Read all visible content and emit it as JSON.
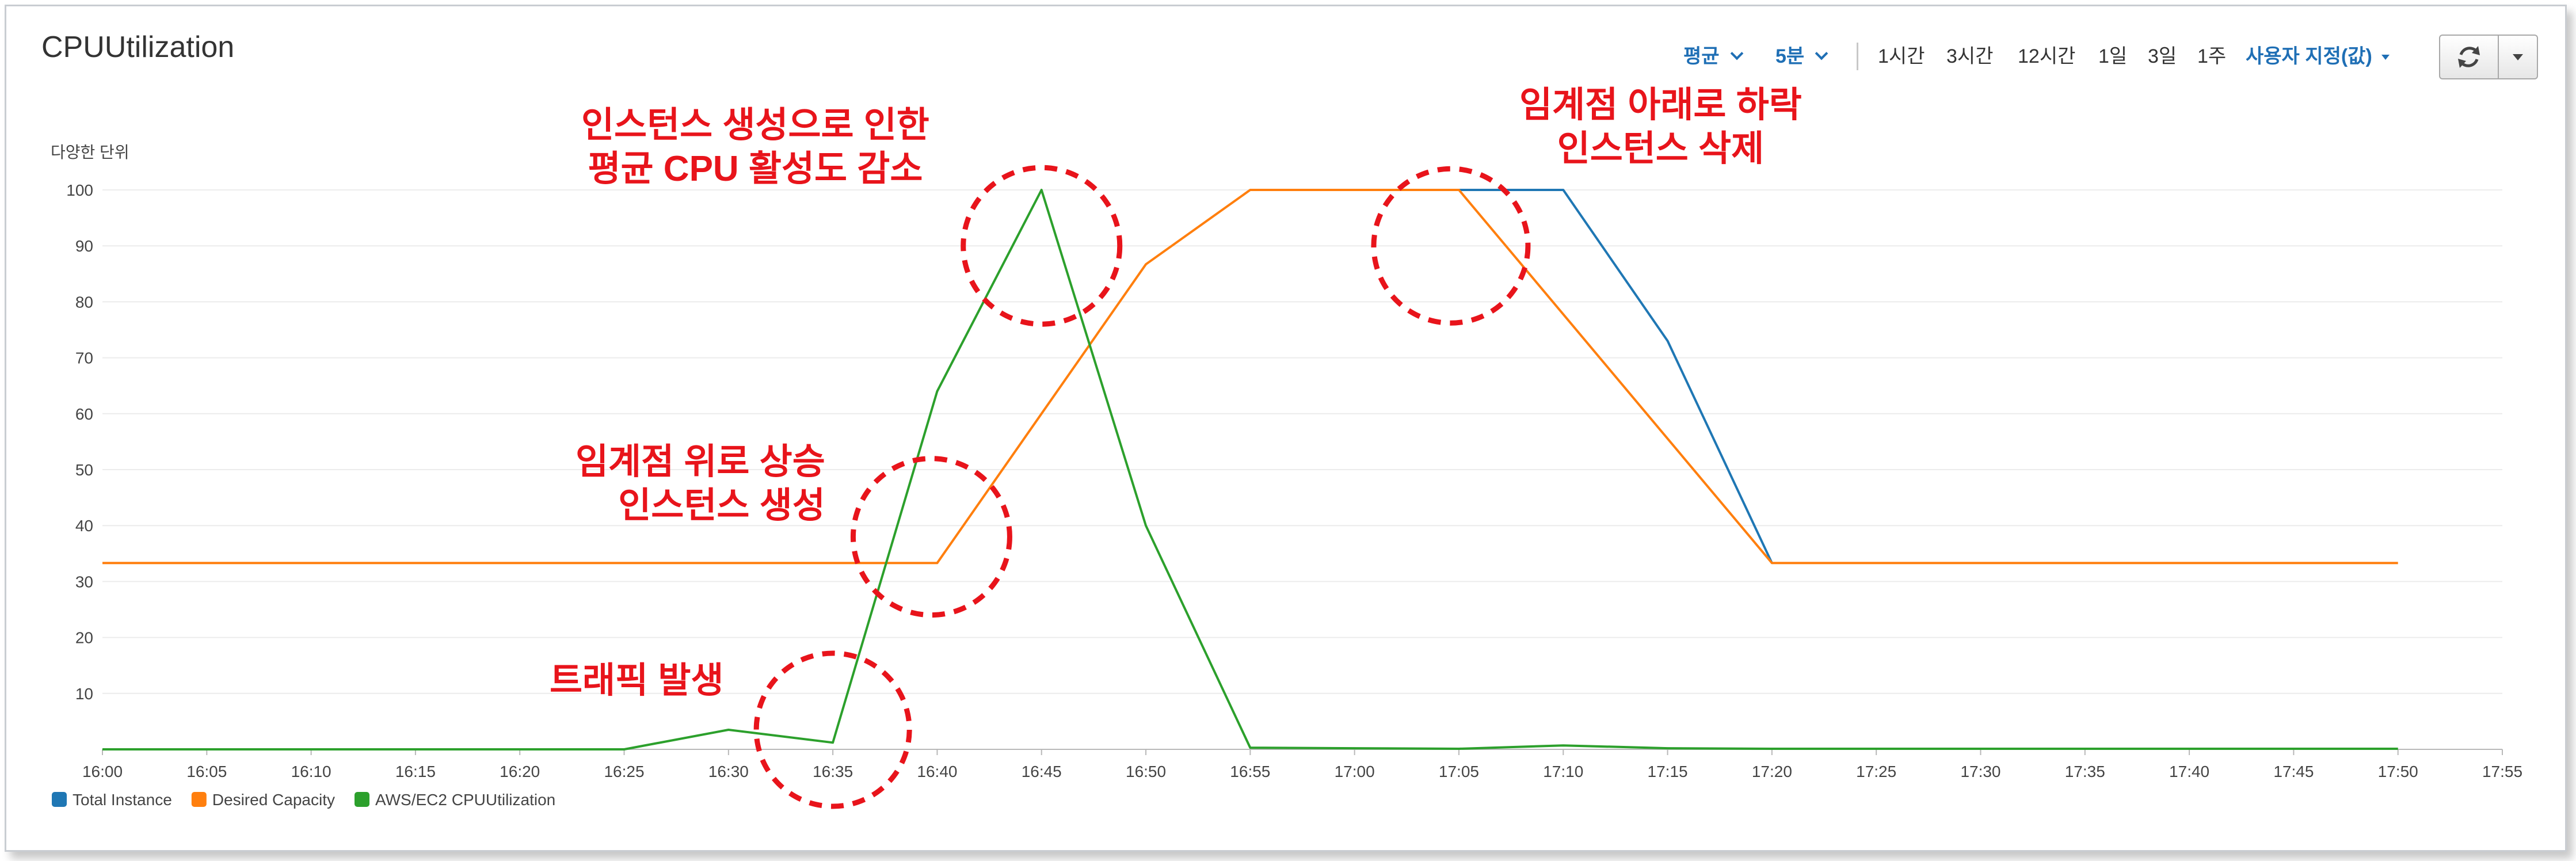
{
  "panel": {
    "title": "CPUUtilization"
  },
  "controls": {
    "statistic": "평균",
    "period": "5분",
    "ranges": [
      "1시간",
      "3시간",
      "12시간",
      "1일",
      "3일",
      "1주"
    ],
    "custom": "사용자 지정(값)",
    "refresh_icon": "refresh-icon",
    "menu_icon": "caret-down-icon"
  },
  "annotations": {
    "instance_avg": [
      "인스턴스 생성으로 인한",
      "평균 CPU 활성도 감소"
    ],
    "below_threshold": [
      "임계점 아래로 하락",
      "인스턴스 삭제"
    ],
    "above_threshold": [
      "임계점 위로 상승",
      "인스턴스 생성"
    ],
    "traffic": "트래픽 발생",
    "color": "#e8141b"
  },
  "chart_data": {
    "type": "line",
    "ylabel": "다양한 단위",
    "x": [
      "16:00",
      "16:05",
      "16:10",
      "16:15",
      "16:20",
      "16:25",
      "16:30",
      "16:35",
      "16:40",
      "16:45",
      "16:50",
      "16:55",
      "17:00",
      "17:05",
      "17:10",
      "17:15",
      "17:20",
      "17:25",
      "17:30",
      "17:35",
      "17:40",
      "17:45",
      "17:50",
      "17:55"
    ],
    "yticks": [
      10,
      20,
      30,
      40,
      50,
      60,
      70,
      80,
      90,
      100
    ],
    "ylim": [
      0,
      100
    ],
    "grid": true,
    "legend_position": "bottom-left",
    "series": [
      {
        "name": "Total Instance",
        "color": "#1f77b4",
        "points": [
          [
            "17:05",
            100
          ],
          [
            "17:10",
            100
          ],
          [
            "17:15",
            73
          ],
          [
            "17:20",
            33.3
          ]
        ]
      },
      {
        "name": "Desired Capacity",
        "color": "#ff7f0e",
        "points": [
          [
            "16:00",
            33.3
          ],
          [
            "16:40",
            33.3
          ],
          [
            "16:50",
            86.7
          ],
          [
            "16:55",
            100
          ],
          [
            "17:05",
            100
          ],
          [
            "17:20",
            33.3
          ],
          [
            "17:50",
            33.3
          ]
        ]
      },
      {
        "name": "AWS/EC2 CPUUtilization",
        "color": "#2ca02c",
        "points": [
          [
            "16:00",
            0
          ],
          [
            "16:25",
            0
          ],
          [
            "16:30",
            3.5
          ],
          [
            "16:35",
            1.2
          ],
          [
            "16:40",
            64
          ],
          [
            "16:45",
            100
          ],
          [
            "16:50",
            40
          ],
          [
            "16:55",
            0.3
          ],
          [
            "17:00",
            0.2
          ],
          [
            "17:05",
            0.1
          ],
          [
            "17:10",
            0.7
          ],
          [
            "17:15",
            0.2
          ],
          [
            "17:20",
            0.1
          ],
          [
            "17:50",
            0.1
          ]
        ]
      }
    ]
  }
}
